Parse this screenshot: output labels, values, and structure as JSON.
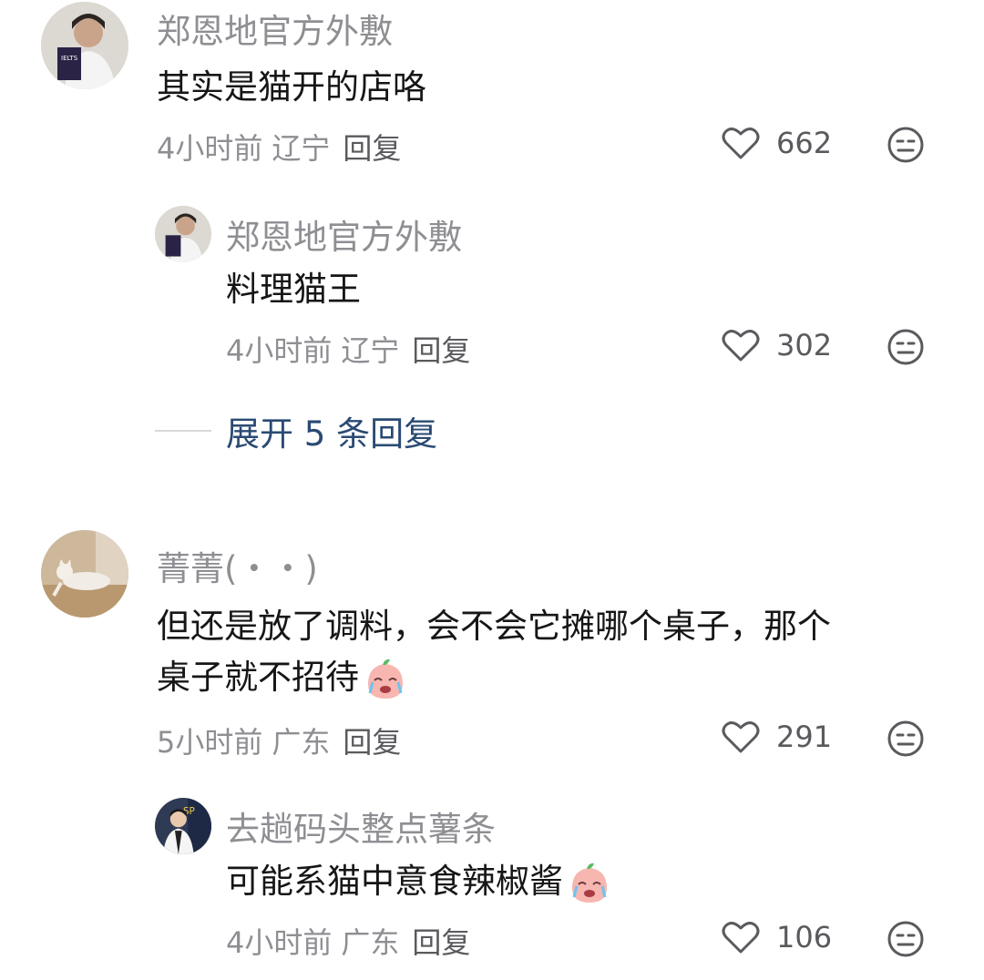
{
  "comments": [
    {
      "user": "郑恩地官方外敷",
      "text": "其实是猫开的店咯",
      "time": "4小时前",
      "location": "辽宁",
      "reply_label": "回复",
      "likes": "662"
    },
    {
      "user": "郑恩地官方外敷",
      "text": "料理猫王",
      "time": "4小时前",
      "location": "辽宁",
      "reply_label": "回复",
      "likes": "302"
    },
    {
      "user": "菁菁(・・)",
      "text_line1": "但还是放了调料，会不会它摊哪个桌子，那个",
      "text_line2": "桌子就不招待",
      "emoji": "crying-peach-emoji",
      "time": "5小时前",
      "location": "广东",
      "reply_label": "回复",
      "likes": "291"
    },
    {
      "user": "去趟码头整点薯条",
      "text": "可能系猫中意食辣椒酱",
      "emoji": "crying-peach-emoji",
      "time": "4小时前",
      "location": "广东",
      "reply_label": "回复",
      "likes": "106"
    }
  ],
  "expand_replies": "展开 5 条回复",
  "colors": {
    "name": "#8e8e93",
    "text": "#161616",
    "link": "#2a4a73",
    "icon": "#5a5a5e"
  },
  "icons": {
    "like": "heart-outline-icon",
    "dislike": "meh-face-icon"
  }
}
